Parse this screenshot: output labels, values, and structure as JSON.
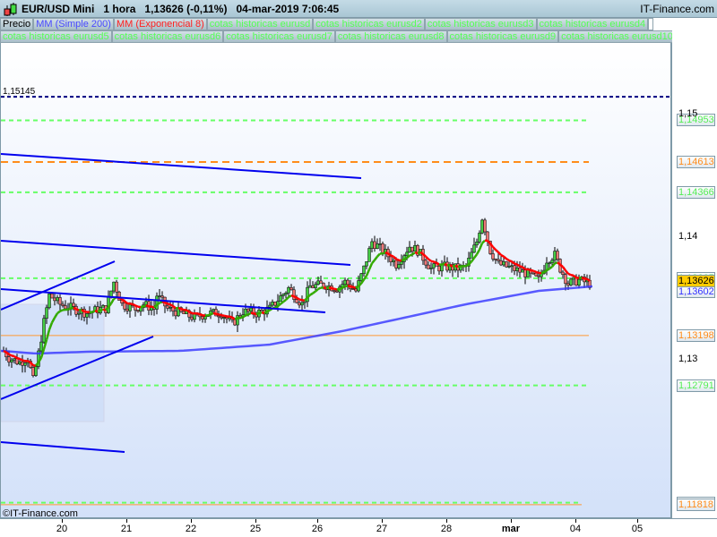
{
  "header": {
    "symbol": "EUR/USD Mini",
    "timeframe": "1 hora",
    "price": "1,13626 (-0,11%)",
    "datetime": "04-mar-2019 7:06:45",
    "brand": "IT-Finance.com"
  },
  "legend": {
    "row1": [
      "Precio",
      "MM (Simple 200)",
      "MM (Exponencial 8)",
      "cotas historicas eurusd",
      "cotas historicas eurusd2",
      "cotas historicas eurusd3",
      "cotas historicas eurusd4"
    ],
    "row2": [
      "cotas historicas eurusd5",
      "cotas historicas eurusd6",
      "cotas historicas eurusd7",
      "cotas historicas eurusd8",
      "cotas historicas eurusd9",
      "cotas historicas eurusd10"
    ]
  },
  "copyright": "©IT-Finance.com",
  "colors": {
    "sma": "#3333ff",
    "ema_up": "#33aa00",
    "ema_down": "#ff0000",
    "green_level": "#55ff55",
    "orange_level": "#ff8c1a",
    "trend": "#0000ee"
  },
  "chart_data": {
    "type": "candlestick",
    "title": "EUR/USD Mini 1 hora",
    "ylim": [
      1.117,
      1.1525
    ],
    "y_ticks": [
      "1,15",
      "1,14",
      "1,13"
    ],
    "y_tick_values": [
      1.15,
      1.14,
      1.13
    ],
    "x_ticks": [
      "20",
      "21",
      "22",
      "25",
      "26",
      "27",
      "28",
      "mar",
      "04",
      "05"
    ],
    "x_tick_bar_index": [
      23,
      47,
      71,
      95,
      118,
      142,
      166,
      190,
      214,
      237
    ],
    "close_path": {
      "bar_index": [
        1,
        3,
        7,
        10,
        12,
        14,
        16,
        18,
        22,
        27,
        32,
        37,
        39,
        42,
        45,
        50,
        53,
        57,
        58,
        62,
        67,
        72,
        77,
        82,
        86,
        90,
        95,
        100,
        103,
        107,
        112,
        115,
        120,
        125,
        128,
        132,
        135,
        138,
        142,
        147,
        152,
        155,
        160,
        165,
        170,
        173,
        177,
        179,
        182,
        185,
        190,
        195,
        200,
        203,
        206,
        208,
        211,
        215,
        219
      ],
      "close": [
        1.13073,
        1.13015,
        1.12978,
        1.13015,
        1.12832,
        1.13051,
        1.13307,
        1.13526,
        1.13453,
        1.13416,
        1.1338,
        1.13416,
        1.13416,
        1.13635,
        1.13453,
        1.13416,
        1.13453,
        1.13416,
        1.13526,
        1.13416,
        1.1338,
        1.13343,
        1.1338,
        1.1338,
        1.13292,
        1.13394,
        1.1338,
        1.13416,
        1.13489,
        1.13584,
        1.13453,
        1.13599,
        1.13613,
        1.13584,
        1.13635,
        1.13562,
        1.13745,
        1.13964,
        1.13891,
        1.13781,
        1.13927,
        1.13891,
        1.13745,
        1.13759,
        1.13745,
        1.13759,
        1.13964,
        1.1416,
        1.13891,
        1.13781,
        1.13745,
        1.13708,
        1.1365,
        1.13818,
        1.13854,
        1.13745,
        1.1362,
        1.1365,
        1.1362
      ]
    },
    "sma200": {
      "bar_index": [
        0,
        13,
        33,
        67,
        100,
        127,
        150,
        173,
        200,
        220
      ],
      "value": [
        1.13073,
        1.13051,
        1.13066,
        1.13073,
        1.13124,
        1.13234,
        1.13343,
        1.13453,
        1.13562,
        1.13599
      ]
    },
    "levels": [
      {
        "label": "1,15145",
        "value": 1.15145,
        "style": "navy-dashed"
      },
      {
        "label": "1,14953",
        "value": 1.14953,
        "style": "green-dashed"
      },
      {
        "label": "1,14613",
        "value": 1.14613,
        "style": "orange-dashed"
      },
      {
        "label": "1,14366",
        "value": 1.14366,
        "style": "green-dashed"
      },
      {
        "label": "1,13665",
        "value": 1.13665,
        "style": "green-dashed"
      },
      {
        "label": "1,13198",
        "value": 1.13198,
        "style": "orange-solid"
      },
      {
        "label": "1,12791",
        "value": 1.12791,
        "style": "green-dashed"
      },
      {
        "label": "1,11835",
        "value": 1.11835,
        "style": "green-dashed"
      },
      {
        "label": "1,11818",
        "value": 1.11818,
        "style": "orange-solid"
      }
    ],
    "current": {
      "label": "1,13626",
      "value": 1.13626
    },
    "sma_current": {
      "label": "1,13602",
      "value": 1.13602
    }
  }
}
